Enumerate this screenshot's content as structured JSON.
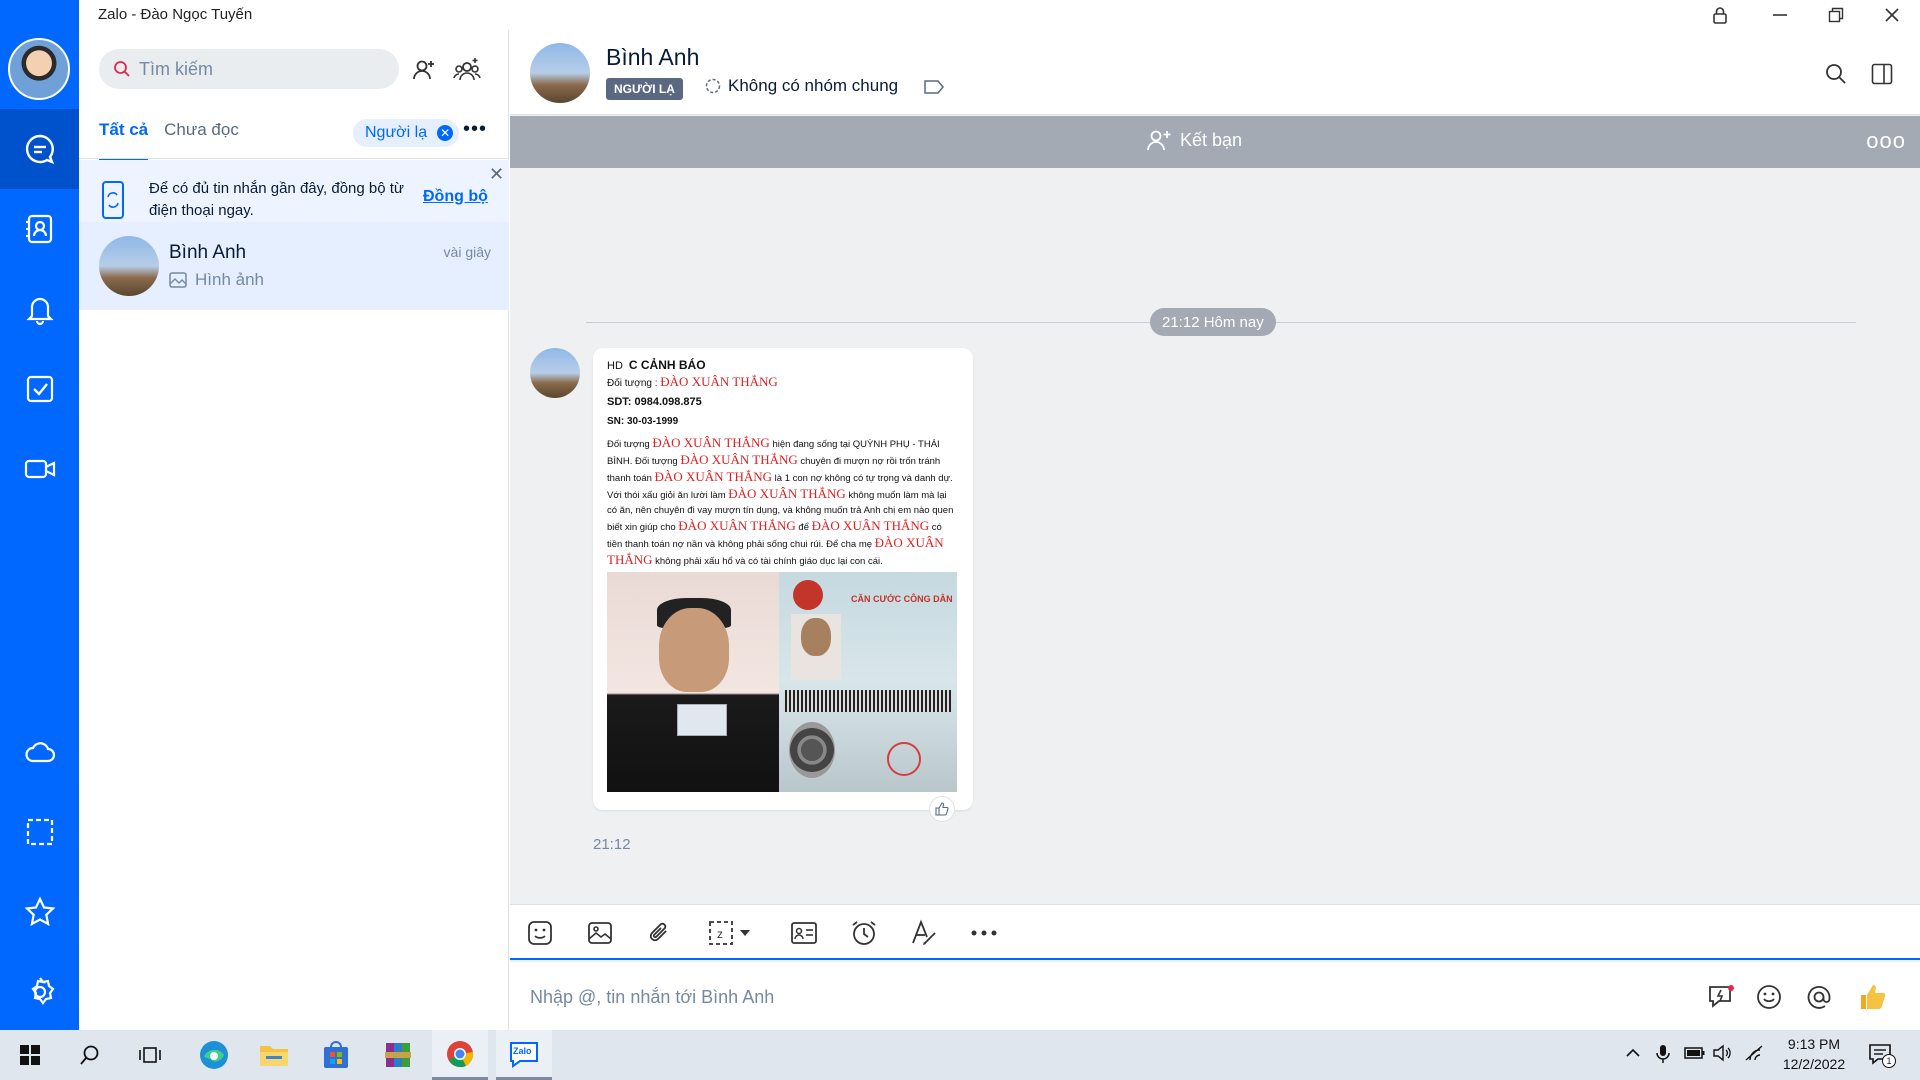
{
  "window": {
    "title": "Zalo - Đào Ngọc Tuyến"
  },
  "sidebar_nav": {
    "items": [
      "messages-icon",
      "contacts-icon",
      "bell-icon",
      "todo-icon",
      "video-call-icon",
      "cloud-icon",
      "capture-icon",
      "star-icon",
      "gear-icon"
    ],
    "active": "messages-icon",
    "accent": "#0068ff"
  },
  "conversation_list": {
    "search_placeholder": "Tìm kiếm",
    "tabs": [
      {
        "label": "Tất cả",
        "active": true
      },
      {
        "label": "Chưa đọc",
        "active": false
      }
    ],
    "filter_chip": "Người lạ",
    "sync_banner": {
      "text": "Để có đủ tin nhắn gần đây, đồng bộ từ điện thoại ngay.",
      "link": "Đồng bộ"
    },
    "items": [
      {
        "name": "Bình Anh",
        "time": "vài giây",
        "preview": "Hình ảnh"
      }
    ]
  },
  "chat": {
    "contact_name": "Bình Anh",
    "stranger_badge": "NGƯỜI LẠ",
    "groups_text": "Không có nhóm chung",
    "add_friend_label": "Kết bạn",
    "date_divider": "21:12 Hôm nay",
    "message": {
      "time": "21:12",
      "doc": {
        "prefix": "HD",
        "heading": "C CẢNH BÁO",
        "subject_label": "Đối tượng :",
        "subject_name": "ĐÀO XUÂN THẮNG",
        "phone": "SDT: 0984.098.875",
        "dob": "SN:  30-03-1999",
        "body_parts": [
          {
            "t": "Đối tượng ",
            "red": false
          },
          {
            "t": "ĐÀO XUÂN THẮNG",
            "red": true
          },
          {
            "t": " hiện đang sống tại QUỲNH PHỤ - THÁI BÌNH. Đối tượng ",
            "red": false
          },
          {
            "t": "ĐÀO XUÂN THẮNG",
            "red": true
          },
          {
            "t": " chuyên đi mượn nợ rồi trốn tránh thanh toán ",
            "red": false
          },
          {
            "t": "ĐÀO XUÂN THẮNG",
            "red": true
          },
          {
            "t": " là 1 con nợ không có tự trọng và danh dự. Với thói xấu giỏi ăn lười làm ",
            "red": false
          },
          {
            "t": "ĐÀO XUÂN THẮNG",
            "red": true
          },
          {
            "t": " không muốn làm mà lại có ăn, nên chuyên đi vay mượn tín dụng, và không muốn trả Anh chị em nào quen biết xin giúp cho ",
            "red": false
          },
          {
            "t": "ĐÀO XUÂN THẮNG",
            "red": true
          },
          {
            "t": " để ",
            "red": false
          },
          {
            "t": "ĐÀO XUÂN THẮNG",
            "red": true
          },
          {
            "t": " có tiền thanh toán nợ nần và không phải sống chui rúi. Để cha mẹ ",
            "red": false
          },
          {
            "t": "ĐÀO XUÂN THẮNG",
            "red": true
          },
          {
            "t": " không phải xấu hổ và có tài chính giáo dục lại con cái.",
            "red": false
          }
        ],
        "id_card_title": "CĂN CƯỚC CÔNG DÂN"
      }
    },
    "input_placeholder": "Nhập @, tin nhắn tới Bình Anh",
    "toolbar_icons": [
      "sticker-icon",
      "image-icon",
      "attachment-icon",
      "screenshot-icon",
      "contact-card-icon",
      "reminder-icon",
      "text-format-icon",
      "more-icon"
    ],
    "input_icons": [
      "quick-message-icon",
      "emoji-icon",
      "mention-icon",
      "thumbs-up-icon"
    ]
  },
  "taskbar": {
    "time": "9:13 PM",
    "date": "12/2/2022",
    "notification_count": "1",
    "zalo_label": "Zalo"
  }
}
